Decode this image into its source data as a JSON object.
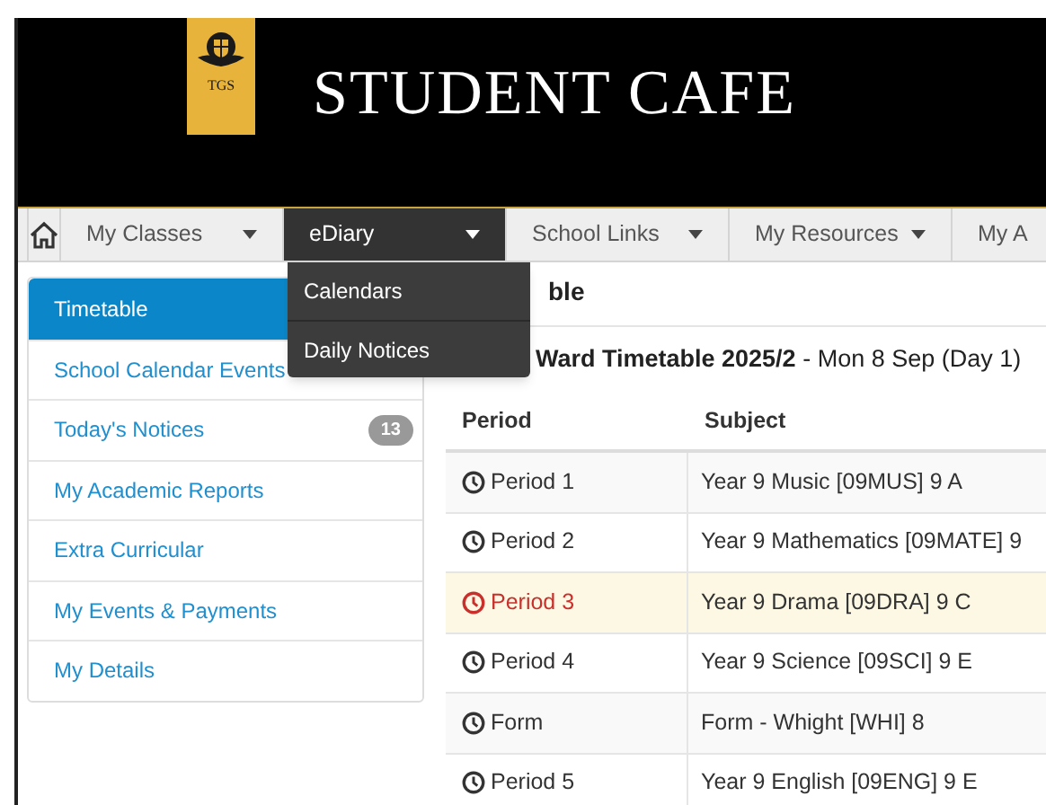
{
  "header": {
    "logo_text": "TGS",
    "title": "STUDENT CAFE"
  },
  "nav": [
    {
      "label": "My Classes",
      "selected": false,
      "caret": true
    },
    {
      "label": "eDiary",
      "selected": true,
      "caret": true
    },
    {
      "label": "School Links",
      "selected": false,
      "caret": true
    },
    {
      "label": "My Resources",
      "selected": false,
      "caret": true
    },
    {
      "label": "My A",
      "selected": false,
      "caret": false
    }
  ],
  "dropdown": [
    "Calendars",
    "Daily Notices"
  ],
  "sidebar": [
    {
      "label": "Timetable",
      "selected": true
    },
    {
      "label": "School Calendar Events",
      "selected": false
    },
    {
      "label": "Today's Notices",
      "selected": false,
      "badge": "13"
    },
    {
      "label": "My Academic Reports",
      "selected": false
    },
    {
      "label": "Extra Curricular",
      "selected": false
    },
    {
      "label": "My Events & Payments",
      "selected": false
    },
    {
      "label": "My Details",
      "selected": false
    }
  ],
  "heading": "ble",
  "subheading": "**Ward Timetable 2025/2** - Mon 8 Sep (Day 1)",
  "table": {
    "columns": [
      "Period",
      "Subject"
    ],
    "rows": [
      {
        "period": "Period 1",
        "subject": "Year 9 Music [09MUS] 9 A",
        "current": false
      },
      {
        "period": "Period 2",
        "subject": "Year 9 Mathematics [09MATE] 9",
        "current": false
      },
      {
        "period": "Period 3",
        "subject": "Year 9 Drama [09DRA] 9 C",
        "current": true
      },
      {
        "period": "Period 4",
        "subject": "Year 9 Science [09SCI] 9 E",
        "current": false
      },
      {
        "period": "Form",
        "subject": "Form - Whight [WHI] 8",
        "current": false
      },
      {
        "period": "Period 5",
        "subject": "Year 9 English [09ENG] 9 E",
        "current": false
      }
    ]
  }
}
